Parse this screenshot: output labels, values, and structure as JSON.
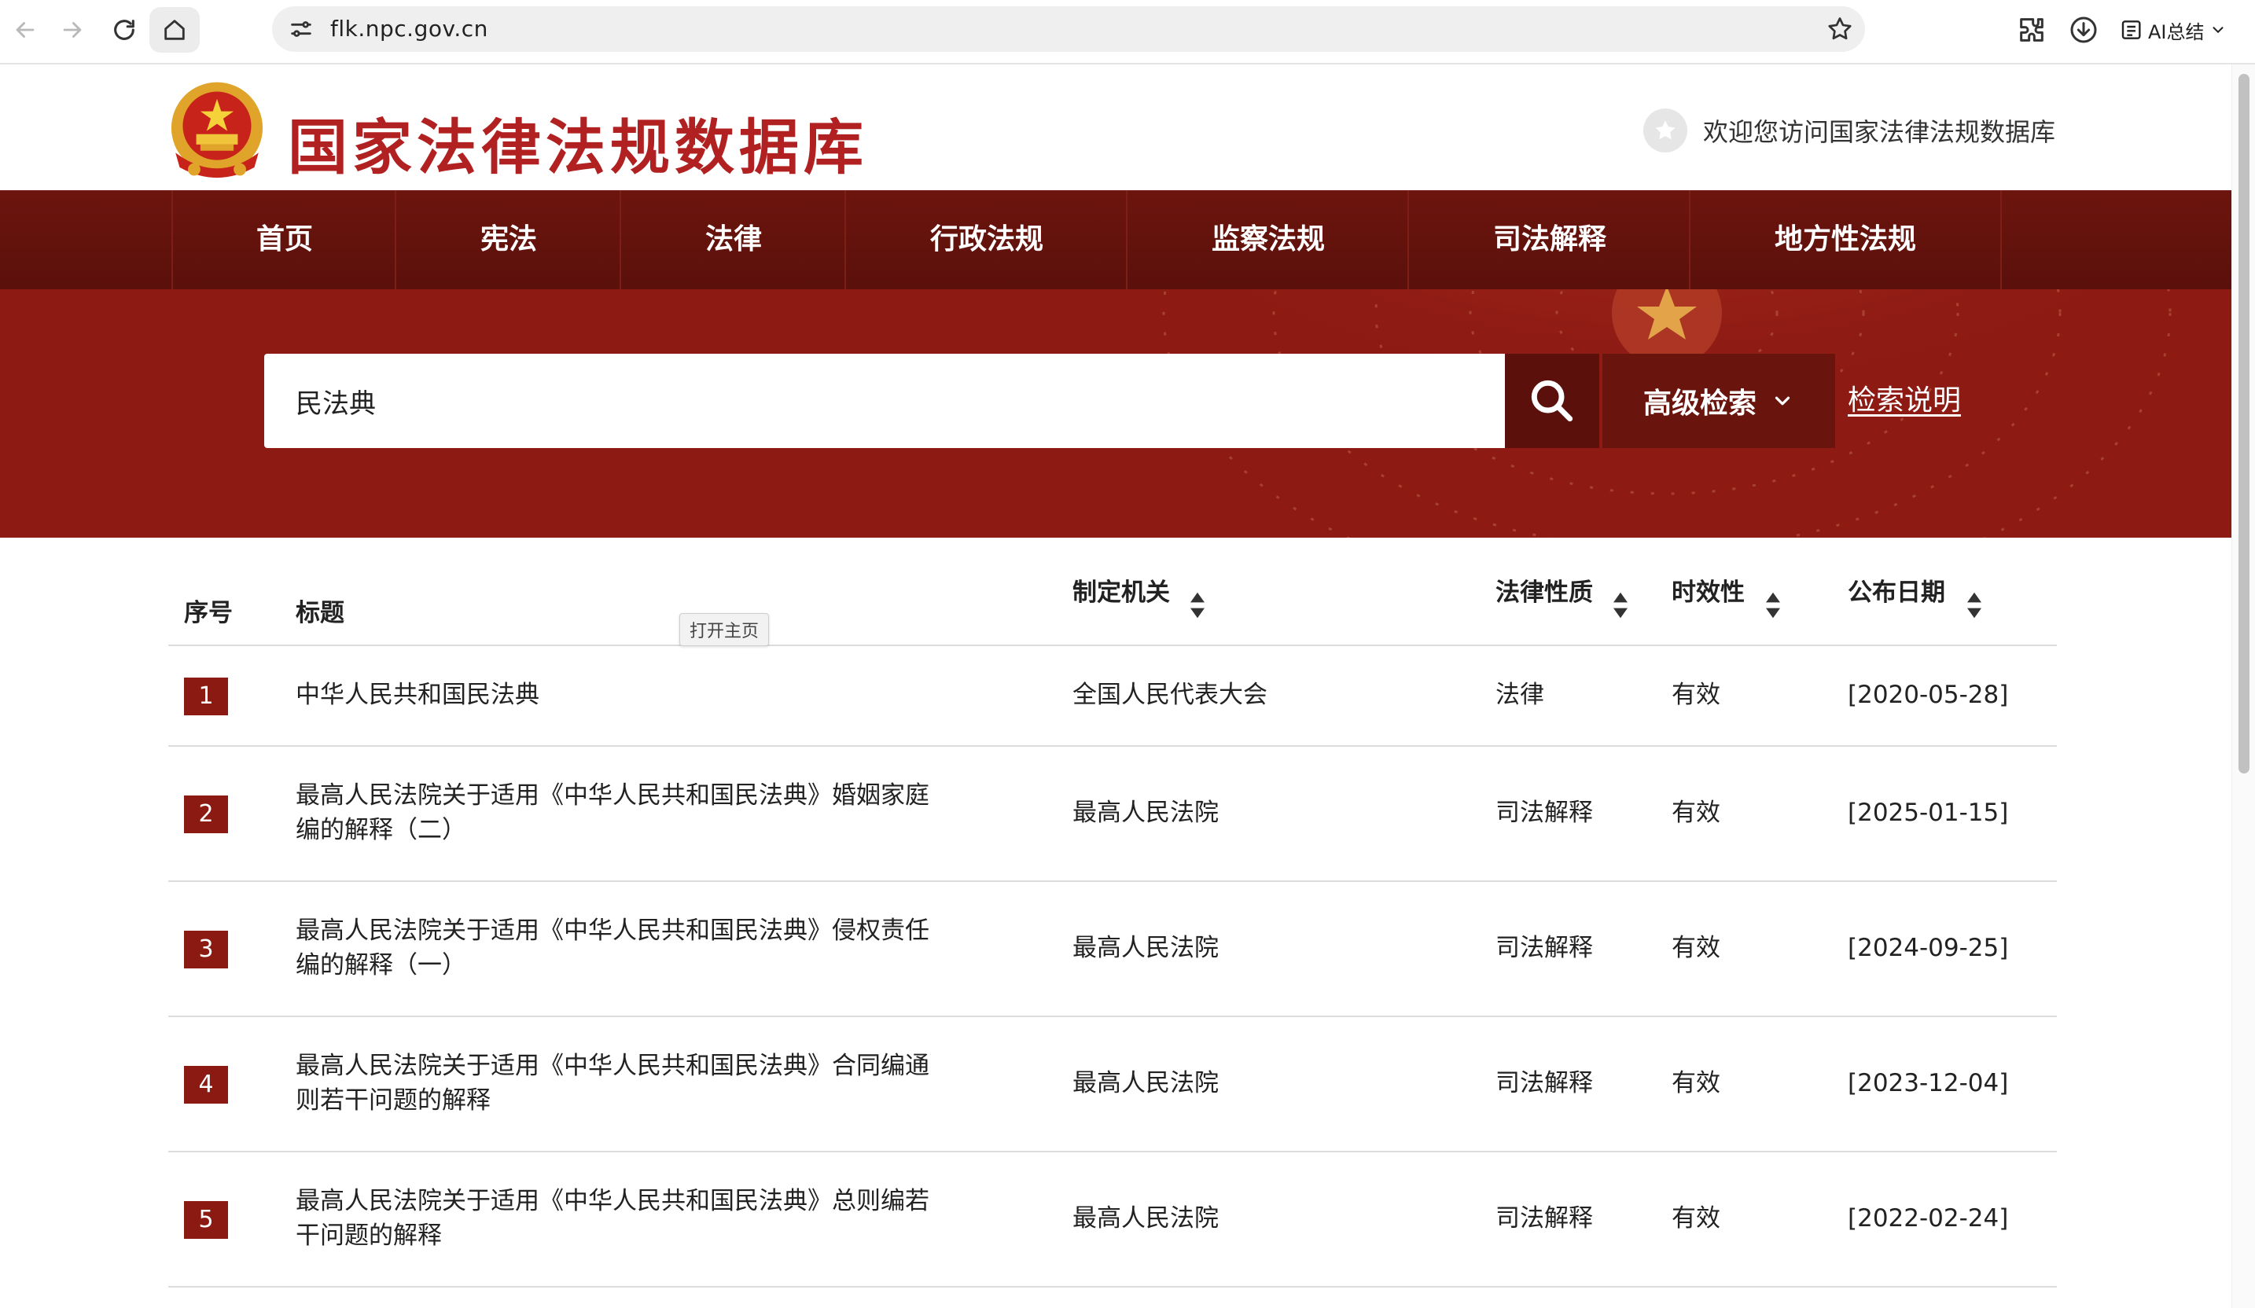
{
  "browser": {
    "url": "flk.npc.gov.cn",
    "ai_summary_label": "AI总结"
  },
  "header": {
    "site_title": "国家法律法规数据库",
    "welcome_text": "欢迎您访问国家法律法规数据库"
  },
  "nav": {
    "items": [
      {
        "label": "首页"
      },
      {
        "label": "宪法"
      },
      {
        "label": "法律"
      },
      {
        "label": "行政法规"
      },
      {
        "label": "监察法规"
      },
      {
        "label": "司法解释"
      },
      {
        "label": "地方性法规"
      }
    ]
  },
  "search": {
    "query": "民法典",
    "advanced_label": "高级检索",
    "help_label": "检索说明"
  },
  "table": {
    "headers": {
      "index": "序号",
      "title": "标题",
      "org": "制定机关",
      "nature": "法律性质",
      "validity": "时效性",
      "date": "公布日期"
    },
    "tooltip": "打开主页",
    "rows": [
      {
        "num": "1",
        "title": "中华人民共和国民法典",
        "org": "全国人民代表大会",
        "nature": "法律",
        "validity": "有效",
        "date": "[2020-05-28]"
      },
      {
        "num": "2",
        "title": "最高人民法院关于适用《中华人民共和国民法典》婚姻家庭编的解释（二）",
        "org": "最高人民法院",
        "nature": "司法解释",
        "validity": "有效",
        "date": "[2025-01-15]"
      },
      {
        "num": "3",
        "title": "最高人民法院关于适用《中华人民共和国民法典》侵权责任编的解释（一）",
        "org": "最高人民法院",
        "nature": "司法解释",
        "validity": "有效",
        "date": "[2024-09-25]"
      },
      {
        "num": "4",
        "title": "最高人民法院关于适用《中华人民共和国民法典》合同编通则若干问题的解释",
        "org": "最高人民法院",
        "nature": "司法解释",
        "validity": "有效",
        "date": "[2023-12-04]"
      },
      {
        "num": "5",
        "title": "最高人民法院关于适用《中华人民共和国民法典》总则编若干问题的解释",
        "org": "最高人民法院",
        "nature": "司法解释",
        "validity": "有效",
        "date": "[2022-02-24]"
      }
    ]
  },
  "colors": {
    "brand_red": "#b12121",
    "nav_bg": "#5b100b",
    "banner_bg": "#8d1b14"
  }
}
